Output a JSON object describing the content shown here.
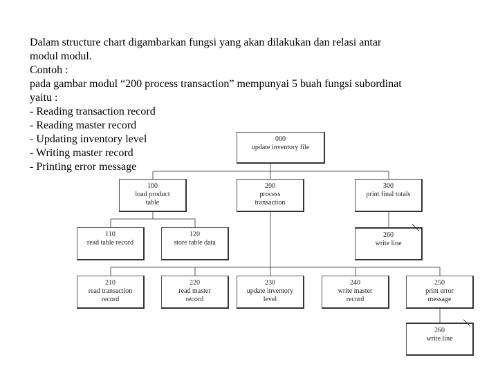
{
  "intro": {
    "paragraph1": "Dalam structure chart digambarkan fungsi yang akan dilakukan dan relasi antar",
    "paragraph1b": "modul modul.",
    "paragraph2": "Contoh :",
    "paragraph3": "pada gambar modul “200 process transaction” mempunyai 5 buah fungsi subordinat",
    "paragraph3b": "yaitu :",
    "functions": [
      "Reading transaction record",
      "Reading master record",
      "Updating inventory level",
      "Writing master record",
      "Printing error message"
    ]
  },
  "diagram": {
    "modules": {
      "m000": {
        "num": "000",
        "label": "update inventory file"
      },
      "m100": {
        "num": "100",
        "label": "load product table"
      },
      "m200": {
        "num": "200",
        "label": "process transaction"
      },
      "m300": {
        "num": "300",
        "label": "print final totals"
      },
      "m110": {
        "num": "110",
        "label": "read table record"
      },
      "m120": {
        "num": "120",
        "label": "store table data"
      },
      "m260a": {
        "num": "260",
        "label": "write line"
      },
      "m210": {
        "num": "210",
        "label": "read transaction record"
      },
      "m220": {
        "num": "220",
        "label": "read master record"
      },
      "m230": {
        "num": "230",
        "label": "update inventory level"
      },
      "m240": {
        "num": "240",
        "label": "write master record"
      },
      "m250": {
        "num": "250",
        "label": "print error message"
      },
      "m260b": {
        "num": "260",
        "label": "write line"
      }
    }
  }
}
